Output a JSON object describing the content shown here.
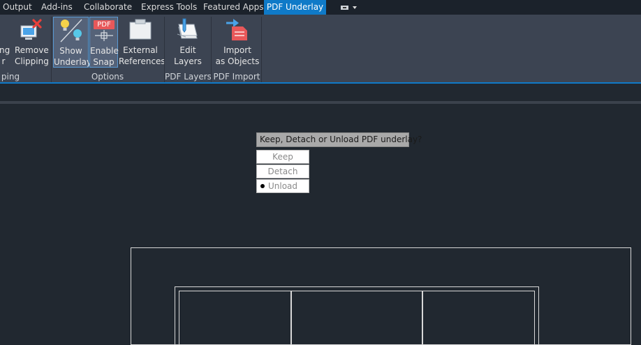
{
  "tabs": [
    {
      "label": "Output"
    },
    {
      "label": "Add-ins"
    },
    {
      "label": "Collaborate"
    },
    {
      "label": "Express Tools"
    },
    {
      "label": "Featured Apps"
    },
    {
      "label": "PDF Underlay",
      "active": true
    }
  ],
  "ribbon": {
    "clipping": {
      "partial_button_lines": [
        "ing",
        "r"
      ],
      "remove_clipping_lines": [
        "Remove",
        "Clipping"
      ],
      "group_label": "ping"
    },
    "options": {
      "show_underlay_lines": [
        "Show",
        "Underlay"
      ],
      "enable_snap_lines": [
        "Enable",
        "Snap"
      ],
      "pdf_badge": "PDF",
      "external_references_lines": [
        "External",
        "References"
      ],
      "group_label": "Options"
    },
    "pdf_layers": {
      "edit_layers_lines": [
        "Edit",
        "Layers"
      ],
      "group_label": "PDF Layers"
    },
    "pdf_import": {
      "import_lines": [
        "Import",
        "as Objects"
      ],
      "group_label": "PDF Import"
    }
  },
  "prompt": {
    "text": "Keep, Detach or Unload PDF underlay?",
    "options": [
      {
        "label": "Keep"
      },
      {
        "label": "Detach"
      },
      {
        "label": "Unload",
        "selected": true
      }
    ]
  },
  "colors": {
    "accent": "#0f7ac8",
    "ribbon_bg": "#3c4452",
    "canvas_bg": "#212830"
  }
}
